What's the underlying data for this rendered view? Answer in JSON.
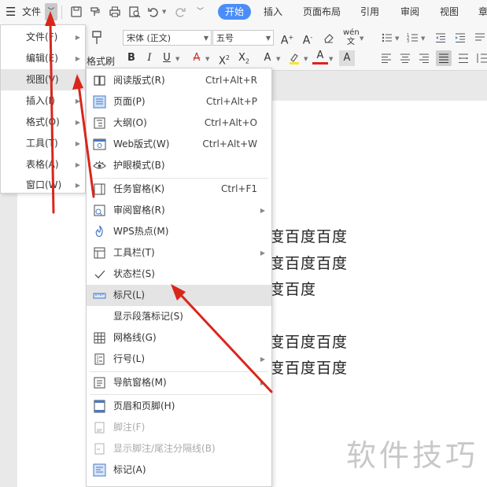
{
  "titlebar": {
    "menu_label": "文件",
    "tabs": [
      "开始",
      "插入",
      "页面布局",
      "引用",
      "审阅",
      "视图",
      "章"
    ]
  },
  "ribbon": {
    "font_name": "宋体 (正文)",
    "font_size": "五号",
    "format_painter": "格式刷"
  },
  "file_menu": {
    "items": [
      {
        "label": "文件(F)"
      },
      {
        "label": "编辑(E)"
      },
      {
        "label": "视图(V)"
      },
      {
        "label": "插入(I)"
      },
      {
        "label": "格式(O)"
      },
      {
        "label": "工具(T)"
      },
      {
        "label": "表格(A)"
      },
      {
        "label": "窗口(W)"
      }
    ],
    "active_index": 2
  },
  "view_menu": {
    "items": [
      {
        "label": "阅读版式(R)",
        "shortcut": "Ctrl+Alt+R",
        "icon": "book-icon"
      },
      {
        "label": "页面(P)",
        "shortcut": "Ctrl+Alt+P",
        "icon": "page-icon"
      },
      {
        "label": "大纲(O)",
        "shortcut": "Ctrl+Alt+O",
        "icon": "outline-icon"
      },
      {
        "label": "Web版式(W)",
        "shortcut": "Ctrl+Alt+W",
        "icon": "web-icon"
      },
      {
        "label": "护眼模式(B)",
        "shortcut": "",
        "icon": "eye-icon"
      },
      {
        "label": "任务窗格(K)",
        "shortcut": "Ctrl+F1",
        "icon": "task-pane-icon"
      },
      {
        "label": "审阅窗格(R)",
        "shortcut": "",
        "icon": "review-pane-icon",
        "submenu": true
      },
      {
        "label": "WPS热点(M)",
        "shortcut": "",
        "icon": "flame-icon"
      },
      {
        "label": "工具栏(T)",
        "shortcut": "",
        "icon": "toolbar-icon",
        "submenu": true
      },
      {
        "label": "状态栏(S)",
        "shortcut": "",
        "icon": "check-icon"
      },
      {
        "label": "标尺(L)",
        "shortcut": "",
        "icon": "ruler-icon",
        "highlighted": true
      },
      {
        "label": "显示段落标记(S)",
        "shortcut": "",
        "icon": ""
      },
      {
        "label": "网格线(G)",
        "shortcut": "",
        "icon": "grid-icon"
      },
      {
        "label": "行号(L)",
        "shortcut": "",
        "icon": "line-number-icon",
        "submenu": true
      },
      {
        "label": "导航窗格(M)",
        "shortcut": "",
        "icon": "navigation-icon",
        "submenu": true
      },
      {
        "label": "页眉和页脚(H)",
        "shortcut": "",
        "icon": "header-footer-icon"
      },
      {
        "label": "脚注(F)",
        "shortcut": "",
        "icon": "footnote-icon",
        "disabled": true
      },
      {
        "label": "显示脚注/尾注分隔线(B)",
        "shortcut": "",
        "icon": "separator-icon",
        "disabled": true
      },
      {
        "label": "标记(A)",
        "shortcut": "",
        "icon": "markup-icon"
      }
    ]
  },
  "document": {
    "lines": [
      "百度百度百度",
      "百度百度百度",
      "百度百度",
      "百度百度百度",
      "百度百度百度"
    ]
  },
  "watermark": "软件技巧",
  "colors": {
    "accent": "#4b8df8",
    "arrow": "#d9261c",
    "menu_highlight": "#e4e4e4"
  }
}
